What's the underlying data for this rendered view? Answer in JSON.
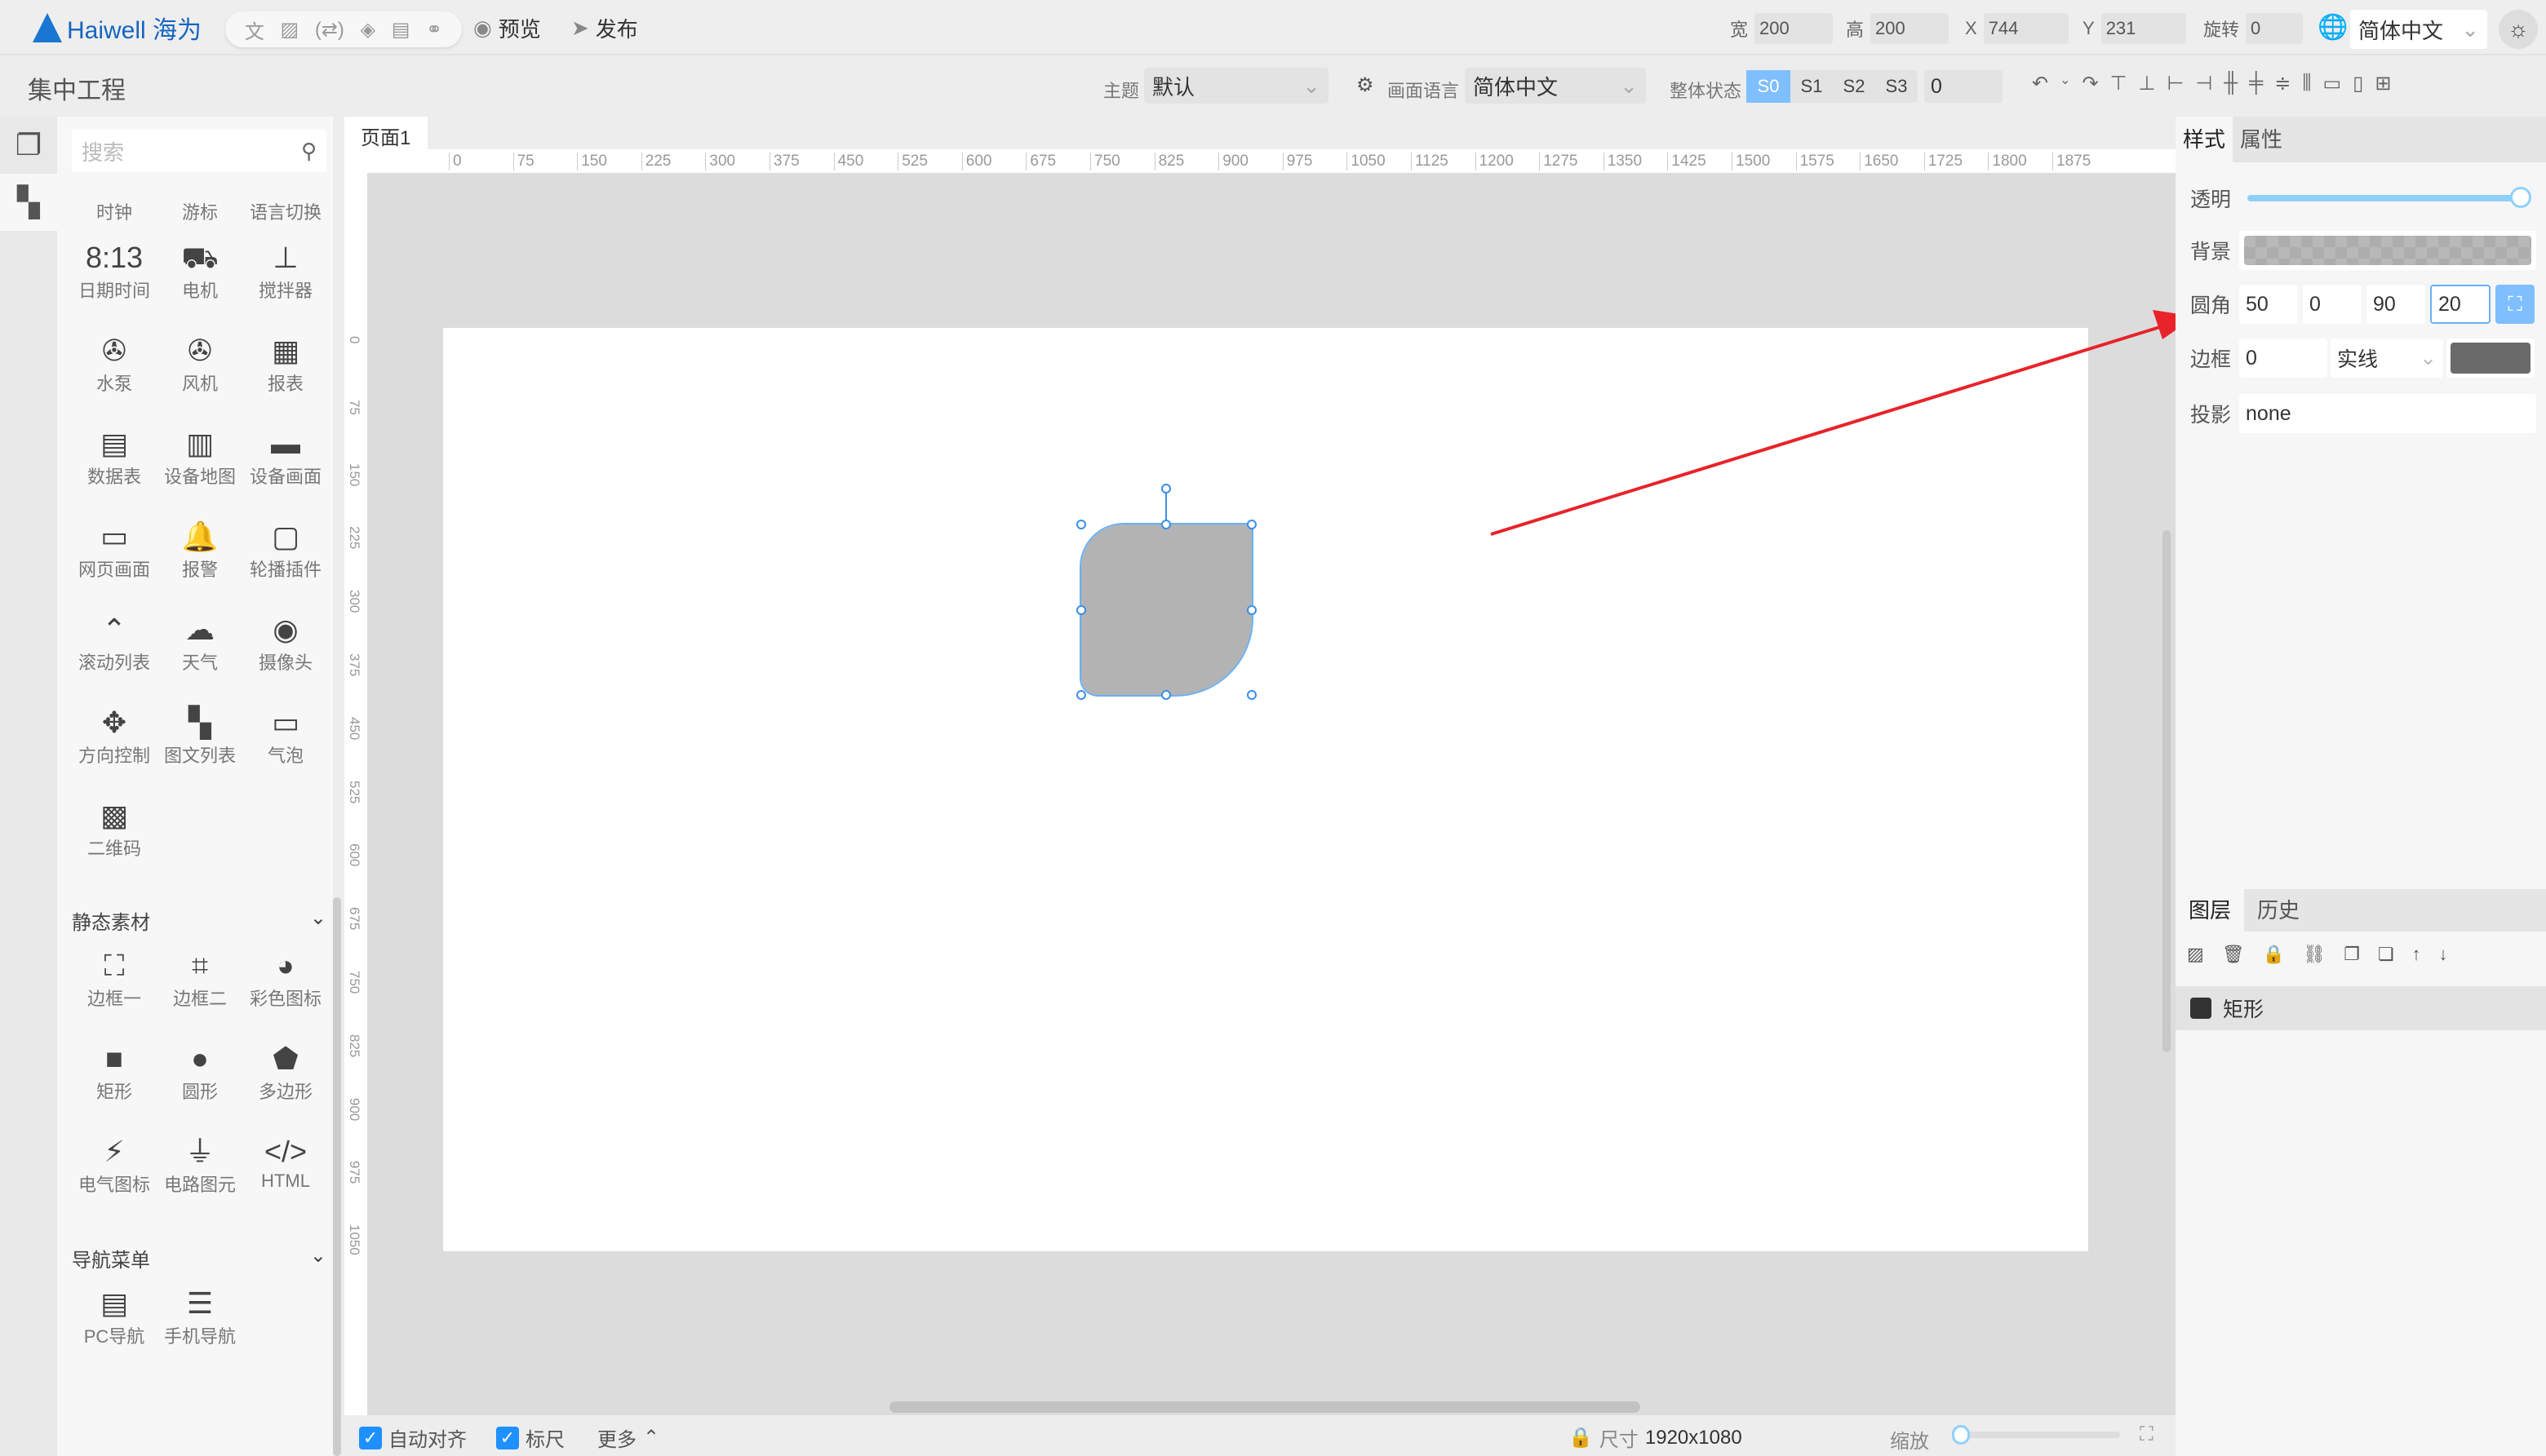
{
  "app": {
    "brand": "Haiwell 海为",
    "project": "集中工程"
  },
  "toolbar": {
    "icons": [
      "translate-icon",
      "image-icon",
      "variable-icon",
      "layers-icon",
      "document-icon",
      "link-icon"
    ],
    "preview": "预览",
    "publish": "发布"
  },
  "geometry_fields": [
    {
      "label": "宽",
      "value": "200"
    },
    {
      "label": "高",
      "value": "200"
    },
    {
      "label": "X",
      "value": "744"
    },
    {
      "label": "Y",
      "value": "231"
    },
    {
      "label": "旋转",
      "value": "0"
    }
  ],
  "language": {
    "selected": "简体中文"
  },
  "second_bar": {
    "theme_label": "主题",
    "theme_value": "默认",
    "screen_lang_label": "画面语言",
    "screen_lang_value": "简体中文",
    "state_label": "整体状态",
    "states": [
      "S0",
      "S1",
      "S2",
      "S3"
    ],
    "active_state": "S0",
    "state_value": "0"
  },
  "left_panel": {
    "search_placeholder": "搜索",
    "top_labels": [
      "时钟",
      "游标",
      "语言切换"
    ],
    "components": [
      {
        "label": "日期时间",
        "icon": "8:13"
      },
      {
        "label": "电机",
        "icon": "⛟"
      },
      {
        "label": "搅拌器",
        "icon": "⊥"
      },
      {
        "label": "水泵",
        "icon": "✇"
      },
      {
        "label": "风机",
        "icon": "✇"
      },
      {
        "label": "报表",
        "icon": "▦"
      },
      {
        "label": "数据表",
        "icon": "▤"
      },
      {
        "label": "设备地图",
        "icon": "▥"
      },
      {
        "label": "设备画面",
        "icon": "▬"
      },
      {
        "label": "网页画面",
        "icon": "▭"
      },
      {
        "label": "报警",
        "icon": "🔔"
      },
      {
        "label": "轮播插件",
        "icon": "▢"
      },
      {
        "label": "滚动列表",
        "icon": "⌃"
      },
      {
        "label": "天气",
        "icon": "☁"
      },
      {
        "label": "摄像头",
        "icon": "◉"
      },
      {
        "label": "方向控制",
        "icon": "✥"
      },
      {
        "label": "图文列表",
        "icon": "▚"
      },
      {
        "label": "气泡",
        "icon": "▭"
      },
      {
        "label": "二维码",
        "icon": "▩"
      }
    ],
    "static_title": "静态素材",
    "static_items": [
      {
        "label": "边框一",
        "icon": "⛶"
      },
      {
        "label": "边框二",
        "icon": "⌗"
      },
      {
        "label": "彩色图标",
        "icon": "◕"
      },
      {
        "label": "矩形",
        "icon": "■"
      },
      {
        "label": "圆形",
        "icon": "●"
      },
      {
        "label": "多边形",
        "icon": "⬟"
      },
      {
        "label": "电气图标",
        "icon": "⚡"
      },
      {
        "label": "电路图元",
        "icon": "⏚"
      },
      {
        "label": "HTML",
        "icon": "</>"
      }
    ],
    "nav_title": "导航菜单",
    "nav_items": [
      {
        "label": "PC导航",
        "icon": "▤"
      },
      {
        "label": "手机导航",
        "icon": "☰"
      }
    ]
  },
  "page_tab": "页面1",
  "ruler": {
    "h": [
      "0",
      "75",
      "150",
      "225",
      "300",
      "375",
      "450",
      "525",
      "600",
      "675",
      "750",
      "825",
      "900",
      "975",
      "1050",
      "1125",
      "1200",
      "1275",
      "1350",
      "1425",
      "1500",
      "1575",
      "1650",
      "1725",
      "1800",
      "1875"
    ],
    "v": [
      "0",
      "75",
      "150",
      "225",
      "300",
      "375",
      "450",
      "525",
      "600",
      "675",
      "750",
      "825",
      "900",
      "975",
      "1050"
    ]
  },
  "shape": {
    "fill": "#b3b3b3",
    "radii": [
      50,
      0,
      90,
      20
    ]
  },
  "annotation": {
    "color": "#e8232a"
  },
  "bottom": {
    "auto_align": "自动对齐",
    "ruler": "标尺",
    "more": "更多",
    "size_label": "尺寸",
    "size_value": "1920x1080",
    "zoom_label": "缩放"
  },
  "right_panel": {
    "tabs": [
      "样式",
      "属性"
    ],
    "opacity_label": "透明",
    "opacity": 1.0,
    "background_label": "背景",
    "radius_label": "圆角",
    "radius": [
      "50",
      "0",
      "90",
      "20"
    ],
    "border_label": "边框",
    "border_width": "0",
    "border_style": "实线",
    "border_color": "#6a6a6a",
    "shadow_label": "投影",
    "shadow": "none",
    "layer_tabs": [
      "图层",
      "历史"
    ],
    "layers": [
      {
        "name": "矩形"
      }
    ]
  }
}
